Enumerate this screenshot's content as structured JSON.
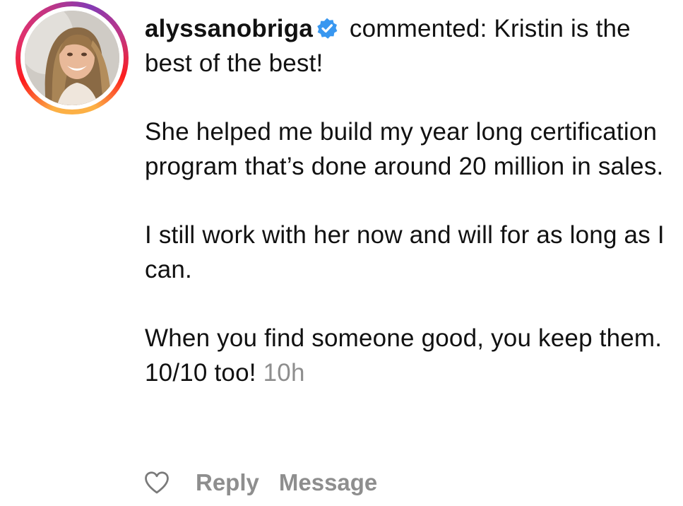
{
  "comment": {
    "username": "alyssanobriga",
    "verified_icon": "verified-badge-icon",
    "verb": " commented: ",
    "paragraphs": [
      "Kristin is the best of the best!",
      "She helped me build my year long certification program that’s done around 20 million in sales.",
      "I still work with her now and will for as long as I can.",
      "When you find someone good, you keep them. 10/10 too!"
    ],
    "timestamp": "10h"
  },
  "actions": {
    "like_icon": "heart-outline-icon",
    "reply_label": "Reply",
    "message_label": "Message"
  },
  "colors": {
    "text": "#111111",
    "muted": "#8e8e8e",
    "verified_blue": "#3897f0",
    "story_ring": [
      "#fcb045",
      "#fd1d1d",
      "#e1306c",
      "#c13584",
      "#833ab4"
    ]
  }
}
